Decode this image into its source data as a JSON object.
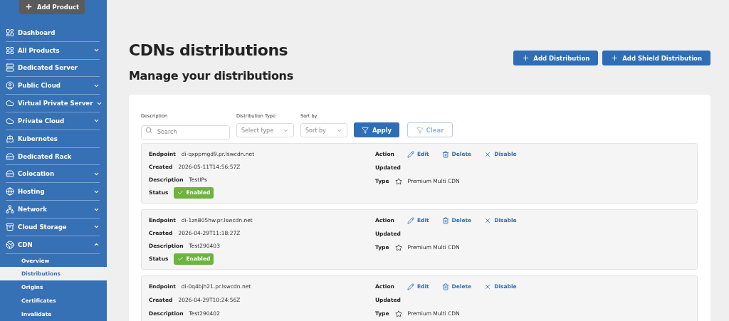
{
  "sidebar": {
    "add_button": "Add Product",
    "items": [
      {
        "label": "Dashboard"
      },
      {
        "label": "All Products",
        "expanded": false
      },
      {
        "label": "Dedicated Server"
      },
      {
        "label": "Public Cloud",
        "expanded": false
      },
      {
        "label": "Virtual Private Server",
        "expanded": false
      },
      {
        "label": "Private Cloud",
        "expanded": false
      },
      {
        "label": "Kubernetes"
      },
      {
        "label": "Dedicated Rack"
      },
      {
        "label": "Colocation",
        "expanded": false
      },
      {
        "label": "Hosting",
        "expanded": false
      },
      {
        "label": "Network",
        "expanded": false
      },
      {
        "label": "Cloud Storage",
        "expanded": false
      },
      {
        "label": "CDN",
        "expanded": true,
        "children": [
          {
            "label": "Overview",
            "selected": false
          },
          {
            "label": "Distributions",
            "selected": true
          },
          {
            "label": "Origins",
            "selected": false
          },
          {
            "label": "Certificates",
            "selected": false
          },
          {
            "label": "Invalidate",
            "selected": false
          }
        ]
      }
    ]
  },
  "header": {
    "title": "CDNs distributions",
    "subtitle": "Manage your distributions",
    "buttons": [
      "Add Distribution",
      "Add Shield Distribution"
    ]
  },
  "filters": {
    "description": {
      "label": "Description",
      "placeholder": "Search"
    },
    "type": {
      "label": "Distribution Type",
      "placeholder": "Select type"
    },
    "sort": {
      "label": "Sort by",
      "placeholder": "Sort by"
    },
    "apply": "Apply",
    "clear": "Clear"
  },
  "distributions": [
    {
      "left": [
        {
          "label": "Endpoint",
          "value": "di-qxppmgd9.pr.lswcdn.net"
        },
        {
          "label": "Created",
          "value": "2026-05-11T14:56:57Z"
        },
        {
          "label": "Description",
          "value": "TestIPs"
        },
        {
          "label": "Status",
          "status": "Enabled",
          "enabled": true
        }
      ],
      "right": [
        {
          "label": "Action",
          "actions": [
            {
              "kind": "edit",
              "label": "Edit"
            },
            {
              "kind": "delete",
              "label": "Delete"
            },
            {
              "kind": "disable",
              "label": "Disable"
            }
          ]
        },
        {
          "label": "Updated"
        },
        {
          "label": "Type",
          "value": "Premium Multi CDN"
        }
      ]
    },
    {
      "left": [
        {
          "label": "Endpoint",
          "value": "di-1zn805hw.pr.lswcdn.net"
        },
        {
          "label": "Created",
          "value": "2026-04-29T11:18:27Z"
        },
        {
          "label": "Description",
          "value": "Test290403"
        },
        {
          "label": "Status",
          "status": "Enabled",
          "enabled": true
        }
      ],
      "right": [
        {
          "label": "Action",
          "actions": [
            {
              "kind": "edit",
              "label": "Edit"
            },
            {
              "kind": "delete",
              "label": "Delete"
            },
            {
              "kind": "disable",
              "label": "Disable"
            }
          ]
        },
        {
          "label": "Updated"
        },
        {
          "label": "Type",
          "value": "Premium Multi CDN"
        }
      ]
    },
    {
      "left": [
        {
          "label": "Endpoint",
          "value": "di-0q4bjh21.pr.lswcdn.net"
        },
        {
          "label": "Created",
          "value": "2026-04-29T10:24:56Z"
        },
        {
          "label": "Description",
          "value": "Test290402"
        }
      ],
      "right": [
        {
          "label": "Action",
          "actions": [
            {
              "kind": "edit",
              "label": "Edit"
            },
            {
              "kind": "delete",
              "label": "Delete"
            },
            {
              "kind": "disable",
              "label": "Disable"
            }
          ]
        },
        {
          "label": "Updated"
        },
        {
          "label": "Type",
          "value": "Premium Multi CDN"
        }
      ]
    }
  ]
}
